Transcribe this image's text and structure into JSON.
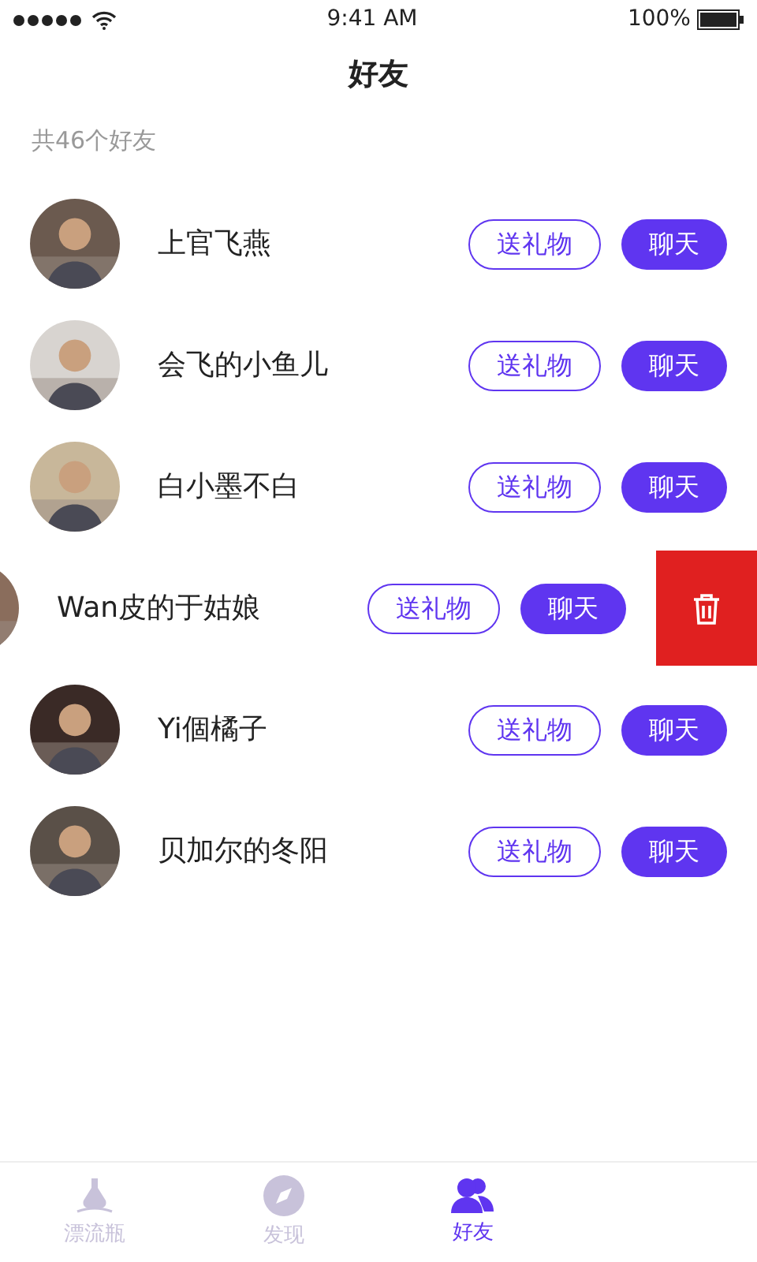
{
  "status_bar": {
    "time": "9:41 AM",
    "battery": "100%"
  },
  "title": "好友",
  "friend_count": "共46个好友",
  "friends": [
    {
      "name": "上官飞燕",
      "swiped": false,
      "gift_button": "送礼物",
      "chat_button": "聊天"
    },
    {
      "name": "会飞的小鱼儿",
      "swiped": false,
      "gift_button": "送礼物",
      "chat_button": "聊天"
    },
    {
      "name": "白小墨不白",
      "swiped": false,
      "gift_button": "送礼物",
      "chat_button": "聊天"
    },
    {
      "name": "Wan皮的于姑娘",
      "swiped": true,
      "gift_button": "送礼物",
      "chat_button": "聊天"
    },
    {
      "name": "Yi個橘子",
      "swiped": false,
      "gift_button": "送礼物",
      "chat_button": "聊天"
    },
    {
      "name": "贝加尔的冬阳",
      "swiped": false,
      "gift_button": "送礼物",
      "chat_button": "聊天"
    }
  ],
  "tab_bar": [
    {
      "label": "漂流瓶",
      "kind": "bottle",
      "selected": false
    },
    {
      "label": "发现",
      "kind": "compass",
      "selected": false
    },
    {
      "label": "好友",
      "kind": "friends",
      "selected": true
    }
  ]
}
